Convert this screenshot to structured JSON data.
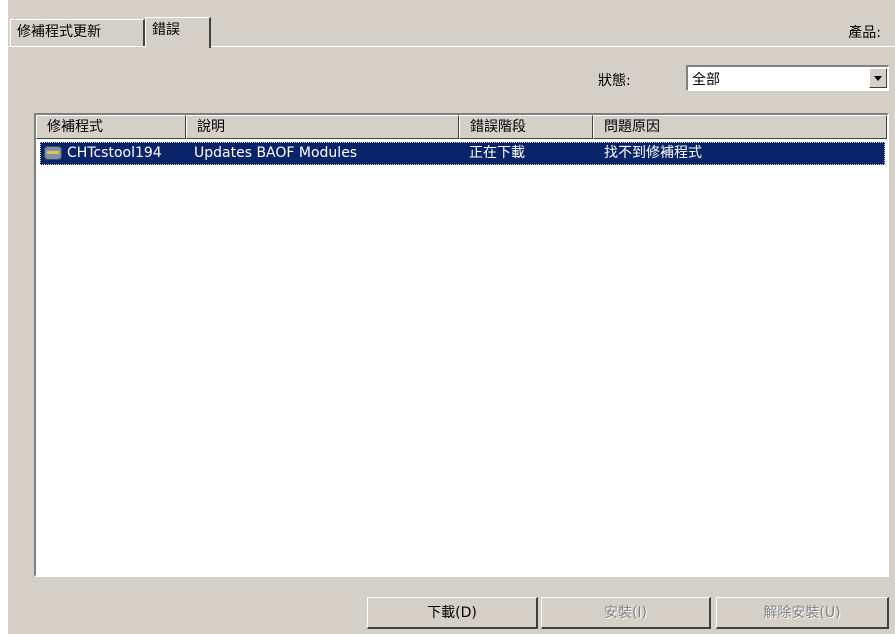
{
  "tabs": [
    {
      "label": "修補程式更新"
    },
    {
      "label": "錯誤"
    }
  ],
  "product_label": "產品:",
  "status_filter": {
    "label": "狀態:",
    "value": "全部"
  },
  "list": {
    "columns": [
      "修補程式",
      "說明",
      "錯誤階段",
      "問題原因"
    ],
    "rows": [
      {
        "patch": "CHTcstool194",
        "description": "Updates BAOF Modules",
        "stage": "正在下載",
        "reason": "找不到修補程式"
      }
    ]
  },
  "buttons": {
    "download": "下載(D)",
    "install": "安裝(I)",
    "uninstall": "解除安裝(U)"
  },
  "colors": {
    "selection": "#0a246a",
    "face": "#d4d0c8"
  }
}
